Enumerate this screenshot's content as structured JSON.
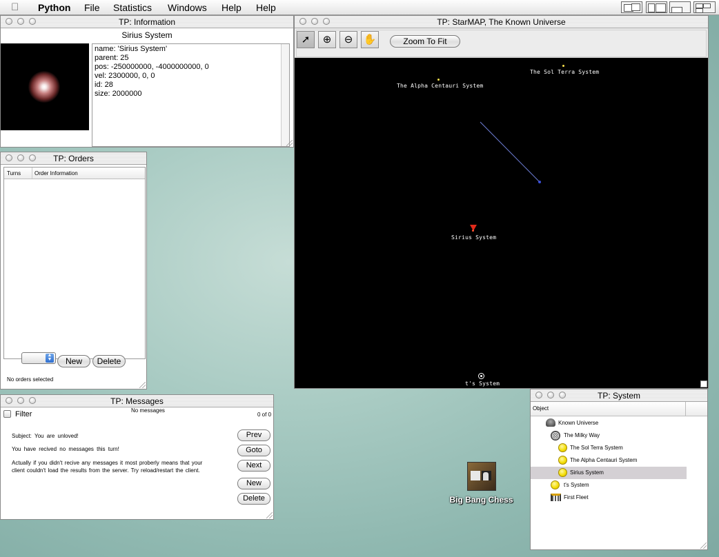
{
  "menubar": {
    "app": "Python",
    "items": [
      "File",
      "Statistics",
      "Windows",
      "Help",
      "Help"
    ]
  },
  "info_window": {
    "title": "TP: Information",
    "heading": "Sirius System",
    "details": [
      "name: 'Sirius System'",
      "parent: 25",
      "pos: -250000000, -4000000000, 0",
      "vel: 2300000, 0, 0",
      "id: 28",
      "size: 2000000"
    ]
  },
  "orders_window": {
    "title": "TP: Orders",
    "columns": [
      "Turns",
      "Order Information"
    ],
    "new_label": "New",
    "delete_label": "Delete",
    "status": "No orders selected"
  },
  "messages_window": {
    "title": "TP: Messages",
    "filter_label": "Filter",
    "count_label": "No messages",
    "page_label": "0 of 0",
    "lines": [
      "Subject:  You  are  unloved!",
      "You  have  recived  no  messages  this  turn!",
      "Actually  if you  didn't  recive  any  messages  it  most  proberly  means  that  your",
      "client  couldn't  load  the  results  from  the  server.  Try  reload/restart  the  client."
    ],
    "buttons": [
      "Prev",
      "Goto",
      "Next",
      "New",
      "Delete"
    ]
  },
  "starmap_window": {
    "title": "TP: StarMAP, The Known Universe",
    "zoom_fit_label": "Zoom To Fit",
    "tools": [
      "pointer-tool",
      "zoom-in-tool",
      "zoom-out-tool",
      "hand-tool"
    ],
    "systems": [
      {
        "name": "The Sol Terra System"
      },
      {
        "name": "The Alpha Centauri System"
      },
      {
        "name": "Sirius System"
      },
      {
        "name": "t's System"
      }
    ],
    "colors": {
      "background": "#000000",
      "star": "#ffe34d",
      "selection": "#e02a1a",
      "path": "#6f7fd8"
    }
  },
  "system_window": {
    "title": "TP: System",
    "column": "Object",
    "tree": [
      {
        "label": "Known Universe",
        "icon": "universe-icon"
      },
      {
        "label": "The Milky Way",
        "icon": "galaxy-icon"
      },
      {
        "label": "The Sol Terra System",
        "icon": "star-system-icon"
      },
      {
        "label": "The Alpha Centauri System",
        "icon": "star-system-icon"
      },
      {
        "label": "Sirius System",
        "icon": "star-system-icon",
        "selected": true
      },
      {
        "label": "t's System",
        "icon": "star-system-icon"
      },
      {
        "label": "First Fleet",
        "icon": "fleet-icon"
      }
    ]
  },
  "desktop": {
    "icon_label": "Big Bang Chess"
  }
}
